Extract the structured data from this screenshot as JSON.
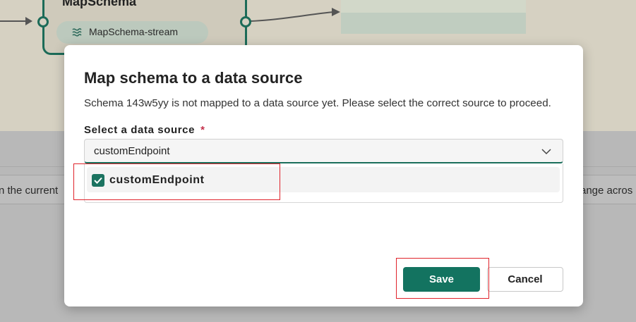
{
  "background": {
    "node_title": "MapSchema",
    "node_chip_label": "MapSchema-stream",
    "info_text_left": "n the current",
    "info_text_right": "ange acros"
  },
  "dialog": {
    "title": "Map schema to a data source",
    "description": "Schema 143w5yy is not mapped to a data source yet. Please select the correct source to proceed.",
    "field_label": "Select a data source",
    "required_marker": "*",
    "selected_value": "customEndpoint",
    "options": [
      {
        "label": "customEndpoint",
        "checked": true
      }
    ],
    "save_label": "Save",
    "cancel_label": "Cancel"
  },
  "colors": {
    "accent": "#137360",
    "highlight": "#e0232b",
    "required": "#c4314b"
  },
  "icons": [
    "stream-icon",
    "chevron-down-icon",
    "checkmark-icon"
  ]
}
